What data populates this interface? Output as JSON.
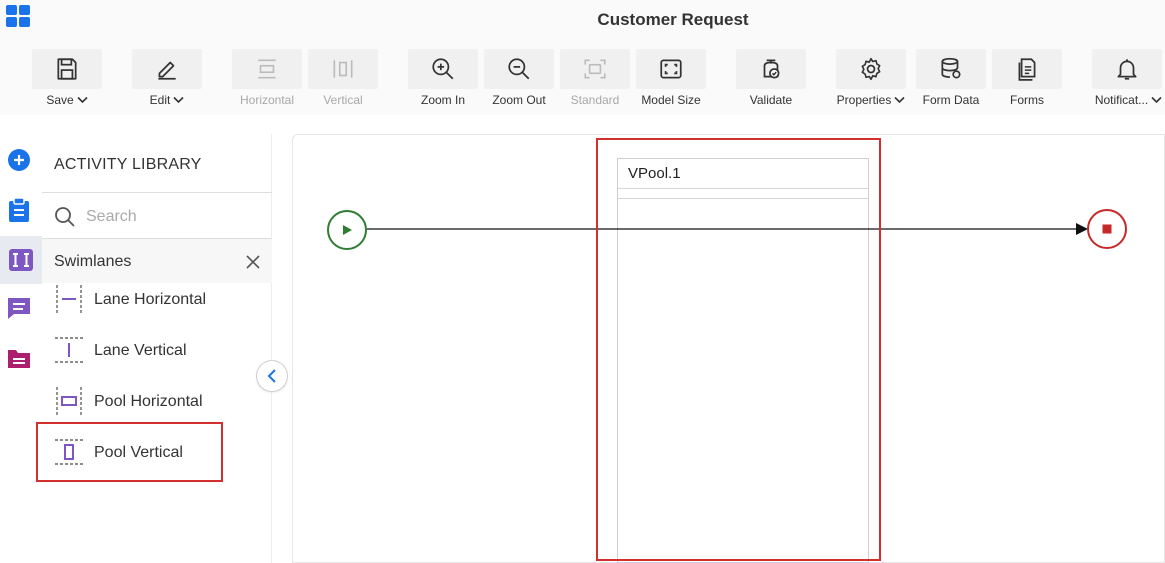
{
  "header": {
    "title": "Customer Request"
  },
  "toolbar": {
    "save": "Save",
    "edit": "Edit",
    "horizontal": "Horizontal",
    "vertical": "Vertical",
    "zoom_in": "Zoom In",
    "zoom_out": "Zoom Out",
    "standard": "Standard",
    "model_size": "Model Size",
    "validate": "Validate",
    "properties": "Properties",
    "form_data": "Form Data",
    "forms": "Forms",
    "notifications": "Notificat..."
  },
  "library": {
    "title": "ACTIVITY LIBRARY",
    "search_placeholder": "Search",
    "group": "Swimlanes",
    "items": [
      {
        "label": "Lane Horizontal",
        "icon": "lane-horizontal-icon"
      },
      {
        "label": "Lane Vertical",
        "icon": "lane-vertical-icon"
      },
      {
        "label": "Pool Horizontal",
        "icon": "pool-horizontal-icon"
      },
      {
        "label": "Pool Vertical",
        "icon": "pool-vertical-icon"
      }
    ]
  },
  "canvas": {
    "pool_title": "VPool.1"
  },
  "colors": {
    "accent": "#1a73e8",
    "purple": "#7e57c2",
    "magenta": "#ad1f6e",
    "start": "#2e7d32",
    "end": "#c62828",
    "highlight": "#d32f2f"
  }
}
